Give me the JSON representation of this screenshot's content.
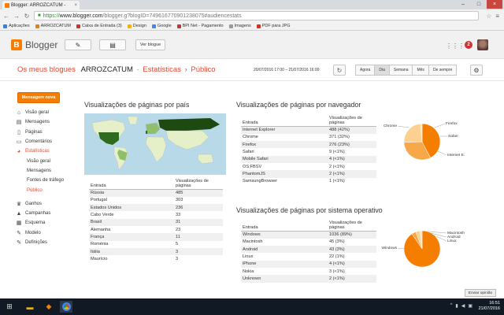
{
  "browser": {
    "tab_title": "Blogger: ARROZCATUM - ",
    "tab_close": "×",
    "url_prefix": "https://",
    "url_host": "www.blogger.com",
    "url_rest": "/blogger.g?blogID=7496167709012380​75#audiencestats",
    "bookmarks": [
      {
        "label": "Aplicações",
        "color": "#3c7de0"
      },
      {
        "label": "ARROZCATUM",
        "color": "#f57d00"
      },
      {
        "label": "Caixa de Entrada (3)",
        "color": "#d93025"
      },
      {
        "label": "Design",
        "color": "#f4b400"
      },
      {
        "label": "Google",
        "color": "#4285f4"
      },
      {
        "label": "BPI Net - Pagamento",
        "color": "#c33"
      },
      {
        "label": "Imagens",
        "color": "#999"
      },
      {
        "label": "PDF para JPG",
        "color": "#d93025"
      }
    ]
  },
  "header": {
    "brand": "Blogger",
    "view_blog": "Ver blogue",
    "notif_count": "2"
  },
  "subheader": {
    "my_blogs": "Os meus blogues",
    "blog_name": "ARROZCATUM",
    "sep": "·",
    "section": "Estatísticas",
    "arrow": "›",
    "page": "Público",
    "range": "20/07/2016 17:00 – 21/07/2016 16:00",
    "periods": [
      {
        "label": "Agora",
        "active": false
      },
      {
        "label": "Dia",
        "active": true
      },
      {
        "label": "Semana",
        "active": false
      },
      {
        "label": "Mês",
        "active": false
      },
      {
        "label": "De sempre",
        "active": false
      }
    ]
  },
  "sidebar": {
    "new_post": "Mensagem nova",
    "items": [
      {
        "label": "Visão geral",
        "icon": "home-icon",
        "glyph": "⌂"
      },
      {
        "label": "Mensagens",
        "icon": "posts-icon",
        "glyph": "▤"
      },
      {
        "label": "Páginas",
        "icon": "pages-icon",
        "glyph": "▯"
      },
      {
        "label": "Comentários",
        "icon": "comments-icon",
        "glyph": "▭"
      },
      {
        "label": "Estatísticas",
        "icon": "stats-icon",
        "glyph": "◕"
      },
      {
        "label": "Visão geral",
        "sub": true
      },
      {
        "label": "Mensagens",
        "sub": true
      },
      {
        "label": "Fontes de tráfego",
        "sub": true
      },
      {
        "label": "Público",
        "sub": true
      },
      {
        "label": "Ganhos",
        "icon": "trophy-icon",
        "glyph": "♛"
      },
      {
        "label": "Campanhas",
        "icon": "campaign-icon",
        "glyph": "▲"
      },
      {
        "label": "Esquema",
        "icon": "layout-icon",
        "glyph": "▦"
      },
      {
        "label": "Modelo",
        "icon": "template-icon",
        "glyph": "✎"
      },
      {
        "label": "Definições",
        "icon": "settings-icon",
        "glyph": "✎"
      }
    ]
  },
  "countries": {
    "title": "Visualizações de páginas por país",
    "col_entry": "Entrada",
    "col_views": "Visualizações de páginas",
    "rows": [
      {
        "label": "Rússia",
        "value": "485"
      },
      {
        "label": "Portugal",
        "value": "303"
      },
      {
        "label": "Estados Unidos",
        "value": "236"
      },
      {
        "label": "Cabo Verde",
        "value": "33"
      },
      {
        "label": "Brasil",
        "value": "31"
      },
      {
        "label": "Alemanha",
        "value": "23"
      },
      {
        "label": "França",
        "value": "11"
      },
      {
        "label": "Roménia",
        "value": "5"
      },
      {
        "label": "Itália",
        "value": "3"
      },
      {
        "label": "Maurício",
        "value": "3"
      }
    ]
  },
  "browsers": {
    "title": "Visualizações de páginas por navegador",
    "col_entry": "Entrada",
    "col_views": "Visualizações de páginas",
    "rows": [
      {
        "label": "Internet Explorer",
        "value": "488 (42%)"
      },
      {
        "label": "Chrome",
        "value": "371 (32%)"
      },
      {
        "label": "Firefox",
        "value": "276 (23%)"
      },
      {
        "label": "Safari",
        "value": "9 (<1%)"
      },
      {
        "label": "Mobile Safari",
        "value": "4 (<1%)"
      },
      {
        "label": "OS;FBSV",
        "value": "2 (<1%)"
      },
      {
        "label": "PhantomJS",
        "value": "2 (<1%)"
      },
      {
        "label": "SamsungBrowser",
        "value": "1 (<1%)"
      }
    ],
    "pie": [
      {
        "label": "Internet E.",
        "value": 488,
        "color": "#f57d00"
      },
      {
        "label": "Chrome",
        "value": 371,
        "color": "#f7a84a"
      },
      {
        "label": "Firefox",
        "value": 276,
        "color": "#fbd090"
      },
      {
        "label": "Safari",
        "value": 18,
        "color": "#ffe7c2"
      }
    ]
  },
  "os": {
    "title": "Visualizações de páginas por sistema operativo",
    "col_entry": "Entrada",
    "col_views": "Visualizações de páginas",
    "rows": [
      {
        "label": "Windows",
        "value": "1036 (89%)"
      },
      {
        "label": "Macintosh",
        "value": "45 (3%)"
      },
      {
        "label": "Android",
        "value": "43 (3%)"
      },
      {
        "label": "Linux",
        "value": "22 (1%)"
      },
      {
        "label": "iPhone",
        "value": "4 (<1%)"
      },
      {
        "label": "Nokia",
        "value": "3 (<1%)"
      },
      {
        "label": "Unknown",
        "value": "2 (<1%)"
      }
    ],
    "pie": [
      {
        "label": "Windows",
        "value": 1036,
        "color": "#f57d00"
      },
      {
        "label": "Macintosh",
        "value": 45,
        "color": "#f7a84a"
      },
      {
        "label": "Android",
        "value": 43,
        "color": "#fbd090"
      },
      {
        "label": "Linux",
        "value": 22,
        "color": "#ffe7c2"
      }
    ]
  },
  "feedback": "Enviar opinião",
  "taskbar": {
    "time": "16:51",
    "date": "21/07/2016"
  }
}
